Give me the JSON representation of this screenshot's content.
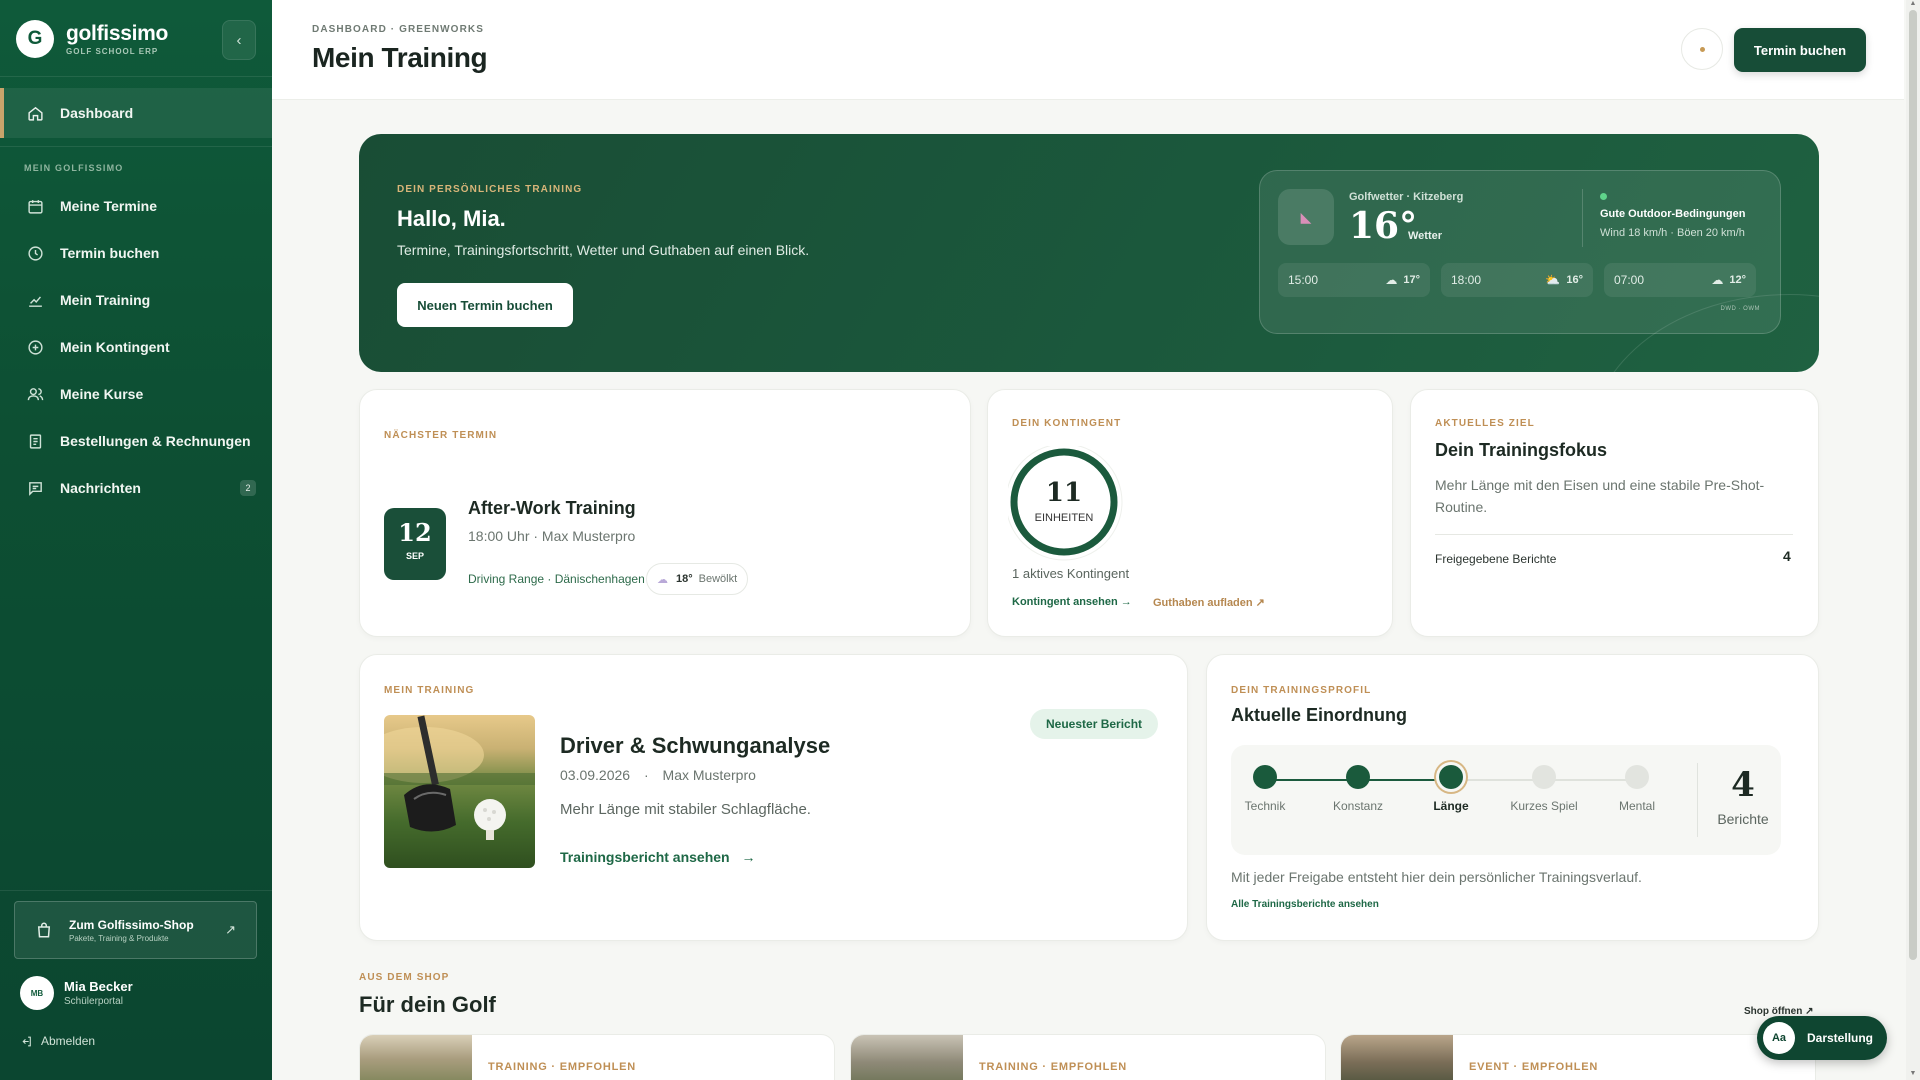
{
  "brand": {
    "name": "golfissimo",
    "subtitle": "GOLF SCHOOL ERP",
    "logo_letter": "G"
  },
  "sidebar": {
    "active": {
      "label": "Dashboard",
      "icon": "home-icon"
    },
    "section_label": "MEIN GOLFISSIMO",
    "items": [
      {
        "label": "Meine Termine",
        "icon": "calendar-icon"
      },
      {
        "label": "Termin buchen",
        "icon": "clock-icon"
      },
      {
        "label": "Mein Training",
        "icon": "chart-icon"
      },
      {
        "label": "Mein Kontingent",
        "icon": "plus-circle-icon"
      },
      {
        "label": "Meine Kurse",
        "icon": "users-icon"
      },
      {
        "label": "Bestellungen & Rechnungen",
        "icon": "receipt-icon"
      },
      {
        "label": "Nachrichten",
        "icon": "message-icon",
        "badge": "2"
      }
    ],
    "shop": {
      "title": "Zum Golfissimo-Shop",
      "subtitle": "Pakete, Training & Produkte"
    },
    "user": {
      "initials": "MB",
      "name": "Mia Becker",
      "role": "Schülerportal"
    },
    "logout": "Abmelden"
  },
  "header": {
    "breadcrumb": "DASHBOARD · GREENWORKS",
    "title": "Mein Training",
    "cta": "Termin buchen"
  },
  "hero": {
    "eyebrow": "DEIN PERSÖNLICHES TRAINING",
    "title": "Hallo, Mia.",
    "description": "Termine, Trainingsfortschritt, Wetter und Guthaben auf einen Blick.",
    "button": "Neuen Termin buchen",
    "weather": {
      "location": "Golfwetter · Kitzeberg",
      "temperature": "16°",
      "condition": "Wetter",
      "status": "Gute Outdoor-Bedingungen",
      "wind": "Wind 18 km/h · Böen 20 km/h",
      "source": "DWD · OWM",
      "forecast": [
        {
          "time": "15:00",
          "icon": "cloud-icon",
          "temp": "17°"
        },
        {
          "time": "18:00",
          "icon": "partly-sunny-icon",
          "temp": "16°"
        },
        {
          "time": "07:00",
          "icon": "cloud-icon",
          "temp": "12°"
        }
      ]
    }
  },
  "next_appointment": {
    "eyebrow": "NÄCHSTER TERMIN",
    "day": "12",
    "month": "SEP",
    "title": "After-Work Training",
    "subtitle": "18:00 Uhr · Max Musterpro",
    "location": "Driving Range · Dänischenhagen",
    "weather_temp": "18°",
    "weather_text": "Bewölkt"
  },
  "contingent": {
    "eyebrow": "DEIN KONTINGENT",
    "units": "11",
    "units_label": "EINHEITEN",
    "active_text": "1 aktives Kontingent",
    "link_view": "Kontingent ansehen",
    "link_topup": "Guthaben aufladen",
    "ring_fill": 1.0
  },
  "goal": {
    "eyebrow": "AKTUELLES ZIEL",
    "title": "Dein Trainingsfokus",
    "description": "Mehr Länge mit den Eisen und eine stabile Pre-Shot-Routine.",
    "reports_label": "Freigegebene Berichte",
    "reports_count": "4"
  },
  "training": {
    "eyebrow": "MEIN TRAINING",
    "badge": "Neuester Bericht",
    "title": "Driver & Schwunganalyse",
    "date": "03.09.2026",
    "coach": "Max Musterpro",
    "description": "Mehr Länge mit stabiler Schlagfläche.",
    "link": "Trainingsbericht ansehen"
  },
  "profile": {
    "eyebrow": "DEIN TRAININGSPROFIL",
    "title": "Aktuelle Einordnung",
    "steps": [
      {
        "label": "Technik",
        "state": "done"
      },
      {
        "label": "Konstanz",
        "state": "done"
      },
      {
        "label": "Länge",
        "state": "current"
      },
      {
        "label": "Kurzes Spiel",
        "state": "open"
      },
      {
        "label": "Mental",
        "state": "open"
      }
    ],
    "reports_num": "4",
    "reports_label": "Berichte",
    "note": "Mit jeder Freigabe entsteht hier dein persönlicher Trainingsverlauf.",
    "link": "Alle Trainingsberichte ansehen"
  },
  "shop": {
    "eyebrow": "AUS DEM SHOP",
    "title": "Für dein Golf",
    "open_link": "Shop öffnen",
    "products": [
      {
        "tag": "TRAINING · EMPFOHLEN"
      },
      {
        "tag": "TRAINING · EMPFOHLEN"
      },
      {
        "tag": "EVENT · EMPFOHLEN"
      }
    ]
  },
  "display_button": {
    "icon_text": "Aa",
    "label": "Darstellung"
  },
  "colors": {
    "brand_green": "#0f5a3a",
    "accent_gold": "#bf8f55",
    "success": "#5fd38a"
  }
}
